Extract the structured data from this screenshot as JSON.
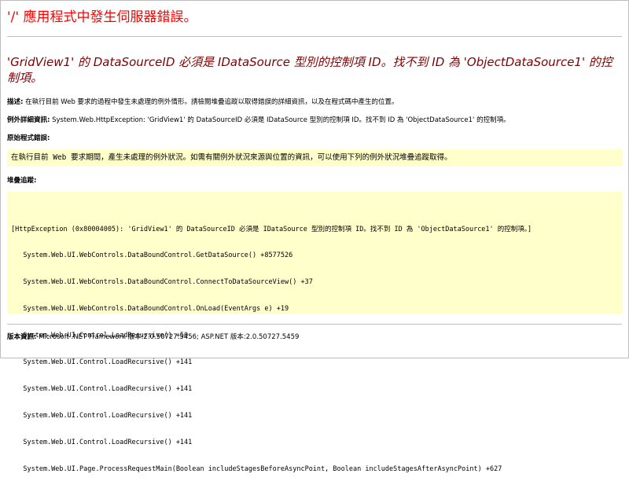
{
  "server_error_title": "'/' 應用程式中發生伺服器錯誤。",
  "error_title": "'GridView1' 的 DataSourceID 必須是 IDataSource 型別的控制項 ID。找不到 ID 為 'ObjectDataSource1' 的控制項。",
  "description": {
    "label": "描述:",
    "text": " 在執行目前 Web 要求的過程中發生未處理的例外情形。請檢閱堆疊追蹤以取得錯誤的詳細資訊，以及在程式碼中產生的位置。"
  },
  "exception_details": {
    "label": "例外詳細資訊:",
    "text": " System.Web.HttpException: 'GridView1' 的 DataSourceID 必須是 IDataSource 型別的控制項 ID。找不到 ID 為 'ObjectDataSource1' 的控制項。"
  },
  "source_error": {
    "label": "原始程式錯誤:",
    "text": "在執行目前 Web 要求期間，產生未處理的例外狀況。如需有關例外狀況來源與位置的資訊，可以使用下列的例外狀況堆疊追蹤取得。"
  },
  "stack_trace": {
    "label": "堆疊追蹤:",
    "lines": [
      "[HttpException (0x80004005): 'GridView1' 的 DataSourceID 必須是 IDataSource 型別的控制項 ID。找不到 ID 為 'ObjectDataSource1' 的控制項。]",
      "   System.Web.UI.WebControls.DataBoundControl.GetDataSource() +8577526",
      "   System.Web.UI.WebControls.DataBoundControl.ConnectToDataSourceView() +37",
      "   System.Web.UI.WebControls.DataBoundControl.OnLoad(EventArgs e) +19",
      "   System.Web.UI.Control.LoadRecursive() +50",
      "   System.Web.UI.Control.LoadRecursive() +141",
      "   System.Web.UI.Control.LoadRecursive() +141",
      "   System.Web.UI.Control.LoadRecursive() +141",
      "   System.Web.UI.Control.LoadRecursive() +141",
      "   System.Web.UI.Page.ProcessRequestMain(Boolean includeStagesBeforeAsyncPoint, Boolean includeStagesAfterAsyncPoint) +627"
    ]
  },
  "version_info": {
    "label": "版本資訊:",
    "text": " Microsoft .NET Framework 版本:2.0.50727.5456; ASP.NET 版本:2.0.50727.5459"
  },
  "colors": {
    "server_title": "#ff0000",
    "error_title": "#800000",
    "code_background": "#ffffcc",
    "rule": "#c0c0c0"
  }
}
